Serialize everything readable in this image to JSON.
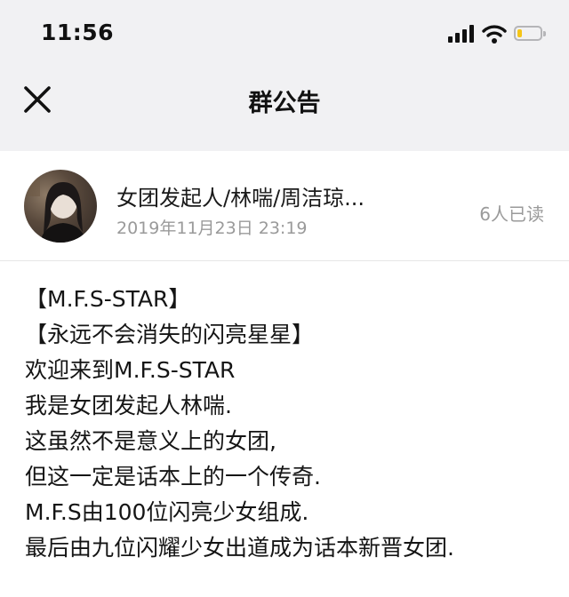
{
  "status_bar": {
    "time": "11:56",
    "battery_level": 0.2,
    "battery_color": "#f5c518",
    "icons": [
      "signal-icon",
      "wifi-icon",
      "battery-icon"
    ]
  },
  "nav": {
    "title": "群公告",
    "close_icon": "close-icon"
  },
  "announcement": {
    "author": "女团发起人/林喘/周洁琼...",
    "date": "2019年11月23日  23:19",
    "read_count": "6人已读",
    "lines": [
      "【M.F.S-STAR】",
      "【永远不会消失的闪亮星星】",
      "欢迎来到M.F.S-STAR",
      "我是女团发起人林喘.",
      "这虽然不是意义上的女团,",
      "但这一定是话本上的一个传奇.",
      "M.F.S由100位闪亮少女组成.",
      "最后由九位闪耀少女出道成为话本新晋女团."
    ]
  }
}
